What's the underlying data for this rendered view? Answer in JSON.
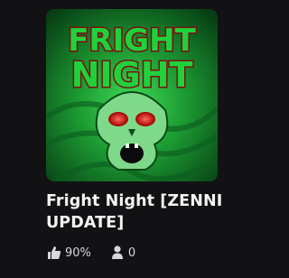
{
  "game": {
    "title": "Fright Night [ZENNI UPDATE]",
    "logo_line1": "FRIGHT",
    "logo_line2": "NIGHT",
    "rating_icon": "thumbs-up-icon",
    "rating": "90%",
    "players_icon": "person-icon",
    "players": "0"
  },
  "colors": {
    "background": "#121215",
    "thumb_green": "#27a83a",
    "logo_green": "#1fd23c",
    "logo_outline": "#7a1010"
  }
}
